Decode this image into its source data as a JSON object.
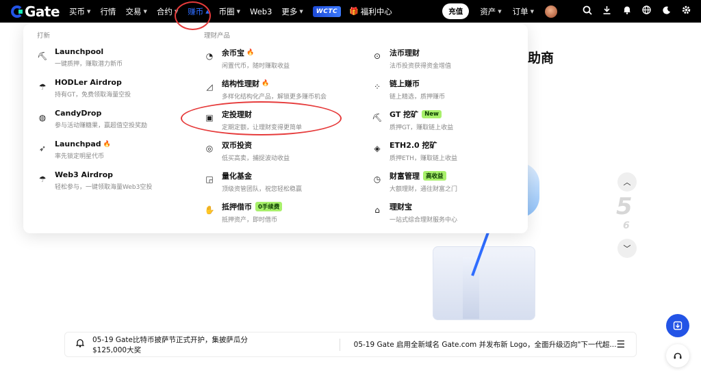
{
  "brand": {
    "name": "Gate"
  },
  "nav": {
    "items": [
      {
        "label": "买币",
        "caret": true
      },
      {
        "label": "行情",
        "caret": false
      },
      {
        "label": "交易",
        "caret": true
      },
      {
        "label": "合约",
        "caret": true
      },
      {
        "label": "赚币",
        "caret": true,
        "active": true
      },
      {
        "label": "币圈",
        "caret": true
      },
      {
        "label": "Web3",
        "caret": false
      },
      {
        "label": "更多",
        "caret": true
      }
    ],
    "wctc_label": "WCTC",
    "welfare_label": "福利中心"
  },
  "topright": {
    "deposit_label": "充值",
    "assets_label": "资产",
    "orders_label": "订单"
  },
  "dropdown": {
    "col1_title": "打新",
    "col2_title": "理财产品",
    "col1": [
      {
        "icon": "pickaxe-icon",
        "title": "Launchpool",
        "desc": "一键质押，赚取潜力新币"
      },
      {
        "icon": "parachute-icon",
        "title": "HODLer Airdrop",
        "desc": "持有GT，免费领取海量空投"
      },
      {
        "icon": "candy-icon",
        "title": "CandyDrop",
        "desc": "参与活动赚糖果，赢超值空投奖励"
      },
      {
        "icon": "rocket-icon",
        "title": "Launchpad",
        "desc": "率先锁定明星代币",
        "fire": true
      },
      {
        "icon": "airdrop-icon",
        "title": "Web3 Airdrop",
        "desc": "轻松参与，一键领取海量Web3空投"
      }
    ],
    "col2": [
      {
        "icon": "piggy-bank-icon",
        "title": "余币宝",
        "desc": "闲置代币，随时赚取收益",
        "fire": true
      },
      {
        "icon": "structured-icon",
        "title": "结构性理财",
        "desc": "多样化结构化产品，解锁更多赚币机会",
        "fire": true
      },
      {
        "icon": "calendar-invest-icon",
        "title": "定投理财",
        "desc": "定期定额，让理财变得更简单"
      },
      {
        "icon": "dual-coin-icon",
        "title": "双币投资",
        "desc": "低买高卖，捕捉波动收益"
      },
      {
        "icon": "quant-fund-icon",
        "title": "量化基金",
        "desc": "顶级资管团队，祝您轻松稳赢"
      },
      {
        "icon": "loan-icon",
        "title": "抵押借币",
        "desc": "抵押资产，即时借币",
        "tag": "0手续费"
      }
    ],
    "col3": [
      {
        "icon": "fiat-icon",
        "title": "法币理财",
        "desc": "法币投资获得资金增值"
      },
      {
        "icon": "chain-earn-icon",
        "title": "链上赚币",
        "desc": "链上精选，质押赚币"
      },
      {
        "icon": "mining-icon",
        "title": "GT 挖矿",
        "desc": "质押GT，赚取链上收益",
        "tag": "New"
      },
      {
        "icon": "eth-icon",
        "title": "ETH2.0 挖矿",
        "desc": "质押ETH，赚取链上收益"
      },
      {
        "icon": "wealth-chart-icon",
        "title": "财富管理",
        "desc": "大额理财，通往财富之门",
        "tag": "高收益"
      },
      {
        "icon": "wallet-icon",
        "title": "理财宝",
        "desc": "一站式综合理财服务中心"
      }
    ]
  },
  "hero": {
    "title_fragment": "助商",
    "page_big": "5",
    "page_small": "6"
  },
  "announcement": {
    "text1": "05-19 Gate比特币披萨节正式开护，集披萨瓜分$125,000大奖",
    "text2": "05-19 Gate 启用全新域名 Gate.com 并发布新 Logo，全面升级迈向\"下一代超..."
  }
}
